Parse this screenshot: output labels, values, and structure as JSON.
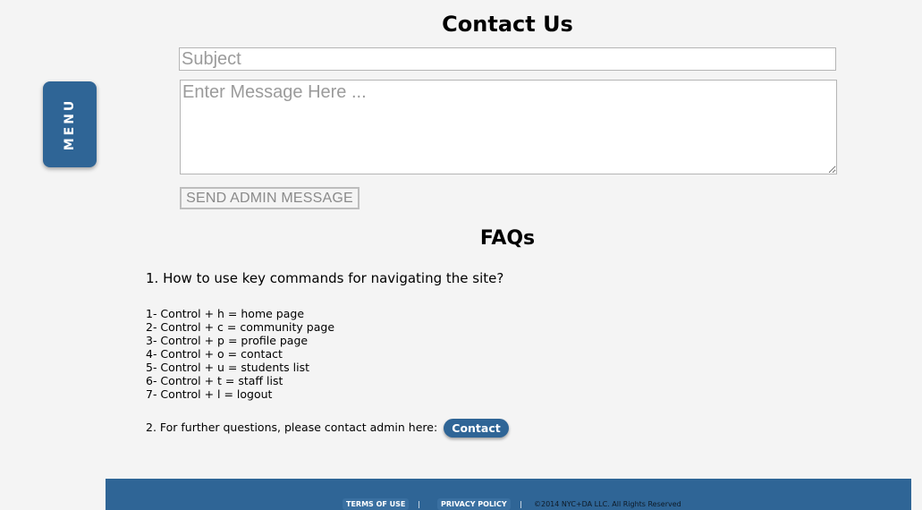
{
  "menu": {
    "label": "MENU"
  },
  "contact": {
    "title": "Contact Us",
    "subject_placeholder": "Subject",
    "message_placeholder": "Enter Message Here ...",
    "send_label": "SEND ADMIN MESSAGE"
  },
  "faq": {
    "title": "FAQs",
    "question_1": "1. How to use key commands for navigating the site?",
    "commands": [
      "1- Control + h = home page",
      "2- Control + c = community page",
      "3- Control + p = profile page",
      "4- Control + o = contact",
      "5- Control + u = students list",
      "6- Control + t = staff list",
      "7- Control + l = logout"
    ],
    "question_2": "2. For further questions, please contact admin here:",
    "contact_button_label": "Contact"
  },
  "footer": {
    "terms_label": "TERMS OF USE",
    "separator": "|",
    "privacy_label": "PRIVACY POLICY",
    "copyright": "©2014 NYC+DA LLC. All Rights Reserved"
  },
  "colors": {
    "accent": "#2f6596",
    "background": "#f4f4f4"
  }
}
